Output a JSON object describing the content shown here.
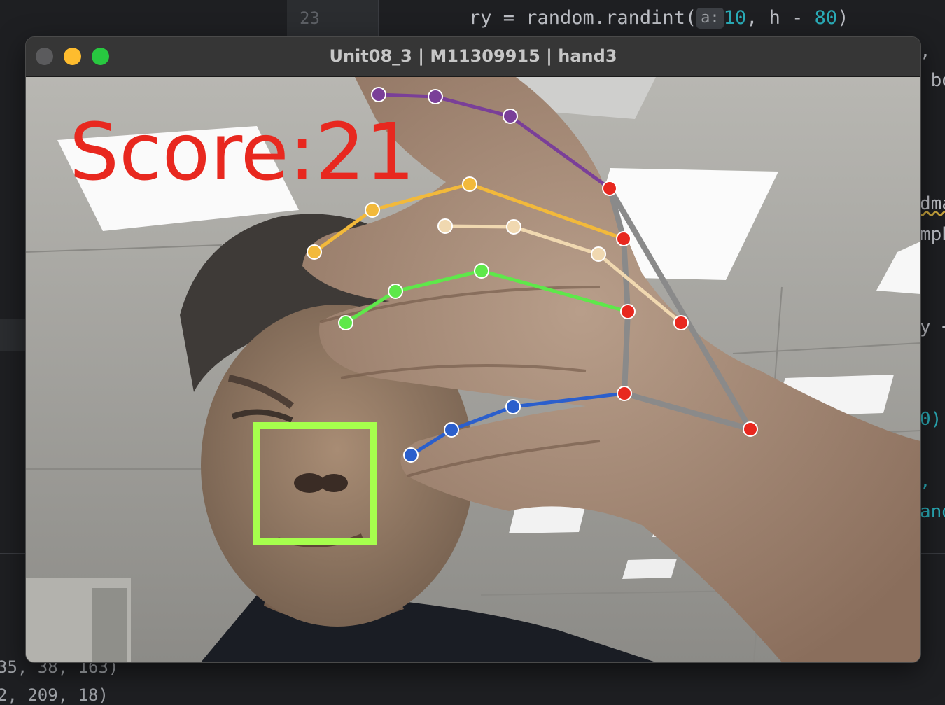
{
  "editor": {
    "line_number": "23",
    "code": {
      "pre": "ry = random.randint(",
      "hint": "a:",
      "n1": "10",
      "mid": ", h - ",
      "n2": "80",
      "post": ")"
    },
    "right_fragments": [
      ",",
      "_bo",
      "dma",
      "mph",
      "y +",
      "0),",
      ",",
      "and"
    ],
    "bottom_lines": [
      "35, 38, 163)",
      "2, 209, 18)"
    ]
  },
  "window": {
    "title": "Unit08_3 | M11309915 | hand3",
    "score_label": "Score:21"
  },
  "colors": {
    "thumb": "#2b5fcc",
    "index": "#5ee84a",
    "middle": "#f0d8b0",
    "ring": "#f2b93b",
    "pinky": "#7a3f98",
    "joint": "#e8281f",
    "palm": "#8a8a8a",
    "target_box": "#a6ff4d",
    "score": "#e8281f"
  }
}
